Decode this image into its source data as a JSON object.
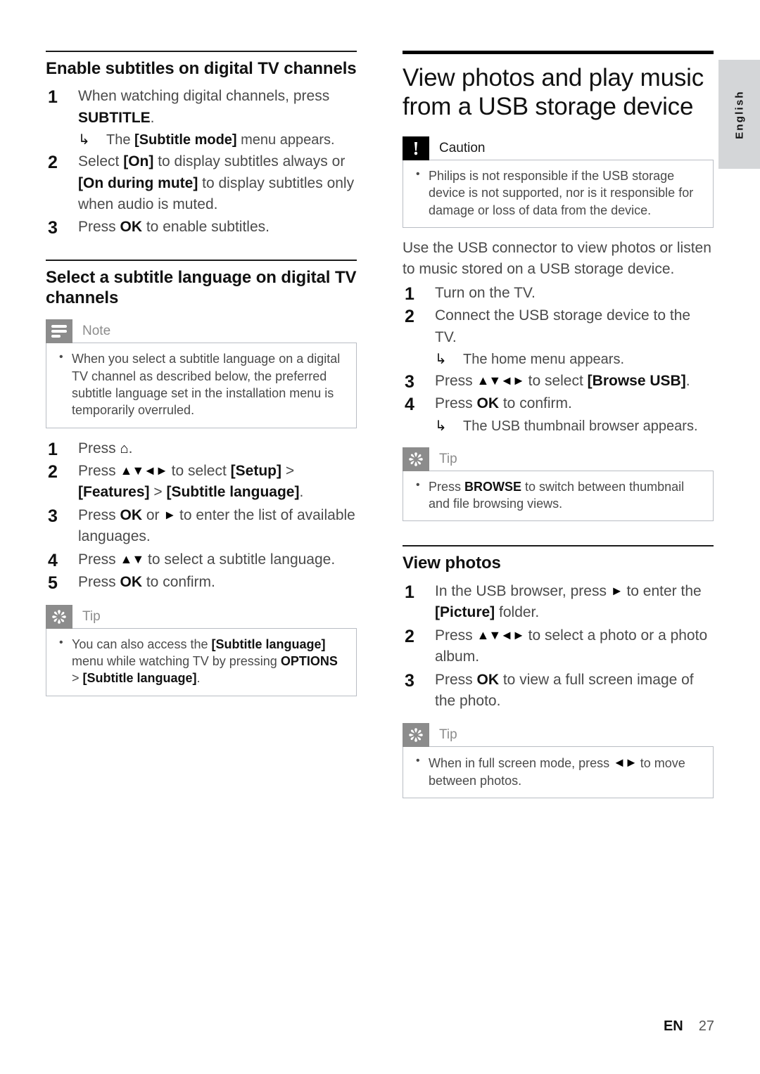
{
  "language_tab": {
    "label": "English"
  },
  "footer": {
    "locale": "EN",
    "page_number": "27"
  },
  "icons": {
    "note": "note-lines-icon",
    "tip": "asterisk-icon",
    "caution": "exclamation-icon",
    "home": "home-icon",
    "sub_arrow": "sub-arrow-icon",
    "nav_updown": "up-down-arrow-keys-icon",
    "nav_all": "up-down-left-right-arrow-keys-icon",
    "nav_leftright": "left-right-arrow-keys-icon",
    "nav_right": "right-arrow-key-icon"
  },
  "left_column": {
    "section1": {
      "heading": "Enable subtitles on digital TV channels",
      "steps": [
        {
          "num": "1",
          "parts": [
            {
              "t": "When watching digital channels, press "
            },
            {
              "t": "SUBTITLE",
              "b": true
            },
            {
              "t": "."
            }
          ],
          "substep": [
            {
              "t": "The "
            },
            {
              "t": "[Subtitle mode]",
              "b": true
            },
            {
              "t": " menu appears."
            }
          ]
        },
        {
          "num": "2",
          "parts": [
            {
              "t": "Select "
            },
            {
              "t": "[On]",
              "b": true
            },
            {
              "t": " to display subtitles always or "
            },
            {
              "t": "[On during mute]",
              "b": true
            },
            {
              "t": " to display subtitles only when audio is muted."
            }
          ]
        },
        {
          "num": "3",
          "parts": [
            {
              "t": "Press "
            },
            {
              "t": "OK",
              "b": true
            },
            {
              "t": " to enable subtitles."
            }
          ]
        }
      ]
    },
    "section2": {
      "heading": "Select a subtitle language on digital TV channels",
      "note": {
        "title": "Note",
        "bullets": [
          "When you select a subtitle language on a digital TV channel as described below, the preferred subtitle language set in the installation menu is temporarily overruled."
        ]
      },
      "steps": [
        {
          "num": "1",
          "parts": [
            {
              "t": "Press "
            },
            {
              "t": "⌂",
              "icon": "home"
            },
            {
              "t": "."
            }
          ]
        },
        {
          "num": "2",
          "parts": [
            {
              "t": "Press "
            },
            {
              "t": "▲▼◄►",
              "keys": true
            },
            {
              "t": " to select "
            },
            {
              "t": "[Setup]",
              "b": true
            },
            {
              "t": " > "
            },
            {
              "t": "[Features]",
              "b": true
            },
            {
              "t": " > "
            },
            {
              "t": "[Subtitle language]",
              "b": true
            },
            {
              "t": "."
            }
          ]
        },
        {
          "num": "3",
          "parts": [
            {
              "t": "Press "
            },
            {
              "t": "OK",
              "b": true
            },
            {
              "t": " or "
            },
            {
              "t": "►",
              "keys": true
            },
            {
              "t": " to enter the list of available languages."
            }
          ]
        },
        {
          "num": "4",
          "parts": [
            {
              "t": "Press "
            },
            {
              "t": "▲▼",
              "keys": true
            },
            {
              "t": " to select a subtitle language."
            }
          ]
        },
        {
          "num": "5",
          "parts": [
            {
              "t": "Press "
            },
            {
              "t": "OK",
              "b": true
            },
            {
              "t": " to confirm."
            }
          ]
        }
      ],
      "tip": {
        "title": "Tip",
        "bullets": [
          [
            {
              "t": "You can also access the "
            },
            {
              "t": "[Subtitle language]",
              "b": true
            },
            {
              "t": " menu while watching TV by pressing "
            },
            {
              "t": "OPTIONS",
              "b": true
            },
            {
              "t": " > "
            },
            {
              "t": "[Subtitle language]",
              "b": true
            },
            {
              "t": "."
            }
          ]
        ]
      }
    }
  },
  "right_column": {
    "chapter_heading": "View photos and play music from a USB storage device",
    "caution": {
      "title": "Caution",
      "bullets": [
        "Philips is not responsible if the USB storage device is not supported, nor is it responsible for damage or loss of data from the device."
      ]
    },
    "intro": "Use the USB connector to view photos or listen to music stored on a USB storage device.",
    "steps": [
      {
        "num": "1",
        "parts": [
          {
            "t": "Turn on the TV."
          }
        ]
      },
      {
        "num": "2",
        "parts": [
          {
            "t": "Connect the USB storage device to the TV."
          }
        ],
        "substep": [
          {
            "t": "The home menu appears."
          }
        ]
      },
      {
        "num": "3",
        "parts": [
          {
            "t": "Press "
          },
          {
            "t": "▲▼◄►",
            "keys": true
          },
          {
            "t": " to select "
          },
          {
            "t": "[Browse USB]",
            "b": true
          },
          {
            "t": "."
          }
        ]
      },
      {
        "num": "4",
        "parts": [
          {
            "t": "Press "
          },
          {
            "t": "OK",
            "b": true
          },
          {
            "t": " to confirm."
          }
        ],
        "substep": [
          {
            "t": "The USB thumbnail browser appears."
          }
        ]
      }
    ],
    "tip1": {
      "title": "Tip",
      "bullets": [
        [
          {
            "t": "Press "
          },
          {
            "t": "BROWSE",
            "b": true
          },
          {
            "t": " to switch between thumbnail and file browsing views."
          }
        ]
      ]
    },
    "section_view_photos": {
      "heading": "View photos",
      "steps": [
        {
          "num": "1",
          "parts": [
            {
              "t": "In the USB browser, press "
            },
            {
              "t": "►",
              "keys": true
            },
            {
              "t": " to enter the "
            },
            {
              "t": "[Picture]",
              "b": true
            },
            {
              "t": " folder."
            }
          ]
        },
        {
          "num": "2",
          "parts": [
            {
              "t": "Press "
            },
            {
              "t": "▲▼◄►",
              "keys": true
            },
            {
              "t": " to select a photo or a photo album."
            }
          ]
        },
        {
          "num": "3",
          "parts": [
            {
              "t": "Press "
            },
            {
              "t": "OK",
              "b": true
            },
            {
              "t": " to view a full screen image of the photo."
            }
          ]
        }
      ],
      "tip": {
        "title": "Tip",
        "bullets": [
          [
            {
              "t": "When in full screen mode, press "
            },
            {
              "t": "◄►",
              "keys": true
            },
            {
              "t": " to move between photos."
            }
          ]
        ]
      }
    }
  }
}
